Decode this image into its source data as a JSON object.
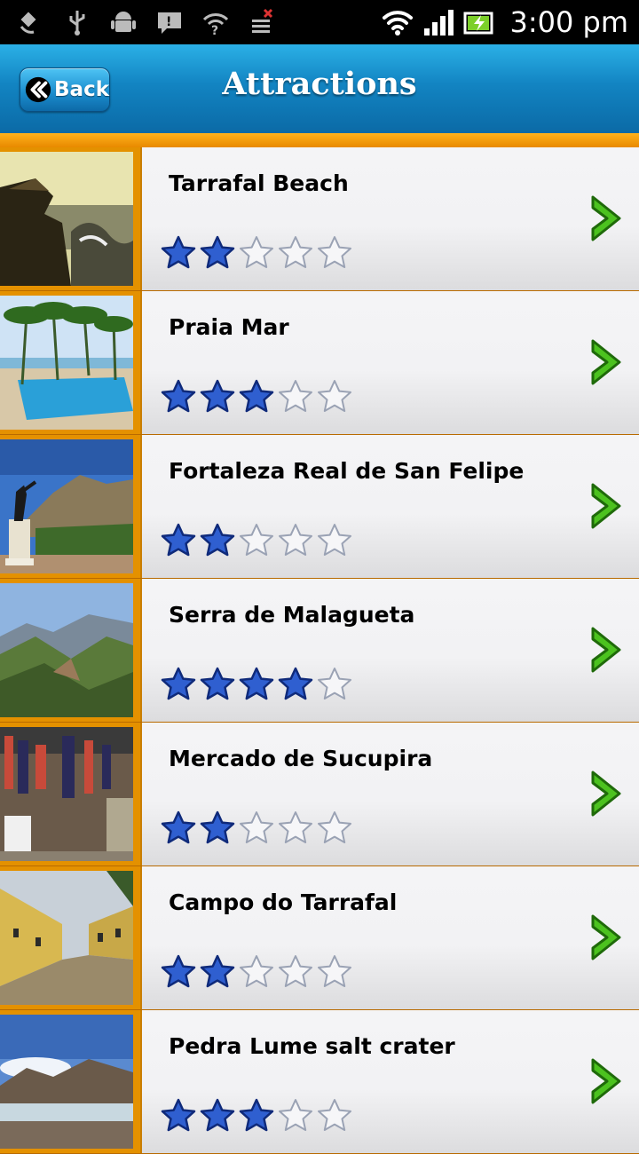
{
  "status_bar": {
    "time": "3:00 pm",
    "left_icons": [
      "satellite-icon",
      "usb-icon",
      "android-icon",
      "message-icon",
      "wifi-question-icon",
      "no-sim-icon"
    ],
    "right_icons": [
      "wifi-icon",
      "signal-icon",
      "battery-icon"
    ]
  },
  "header": {
    "back_label": "Back",
    "title": "Attractions"
  },
  "colors": {
    "header_blue": "#1284c2",
    "accent_orange": "#e49100",
    "star_blue": "#2f5fd0",
    "arrow_green": "#3aab1a"
  },
  "attractions": [
    {
      "name": "Tarrafal Beach",
      "rating": 2,
      "max_rating": 5,
      "thumbnail": "sea-rocks-photo"
    },
    {
      "name": "Praia Mar",
      "rating": 3,
      "max_rating": 5,
      "thumbnail": "pool-palms-photo"
    },
    {
      "name": "Fortaleza Real de San Felipe",
      "rating": 2,
      "max_rating": 5,
      "thumbnail": "fortress-statue-photo"
    },
    {
      "name": "Serra de Malagueta",
      "rating": 4,
      "max_rating": 5,
      "thumbnail": "mountains-photo"
    },
    {
      "name": "Mercado de Sucupira",
      "rating": 2,
      "max_rating": 5,
      "thumbnail": "market-stalls-photo"
    },
    {
      "name": "Campo do Tarrafal",
      "rating": 2,
      "max_rating": 5,
      "thumbnail": "yellow-buildings-photo"
    },
    {
      "name": "Pedra Lume salt crater",
      "rating": 3,
      "max_rating": 5,
      "thumbnail": "salt-crater-photo"
    }
  ]
}
